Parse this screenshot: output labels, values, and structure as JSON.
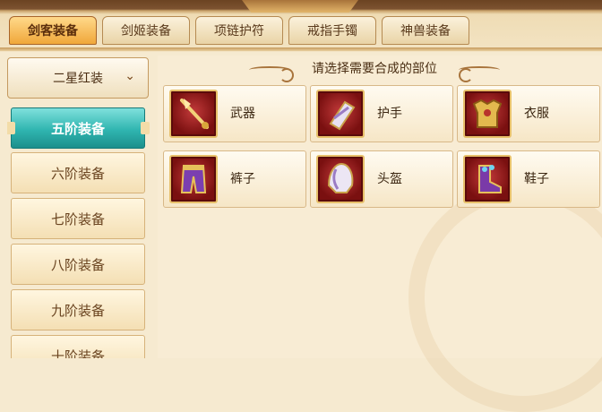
{
  "tabs": [
    {
      "label": "剑客装备",
      "active": true
    },
    {
      "label": "剑姬装备",
      "active": false
    },
    {
      "label": "项链护符",
      "active": false
    },
    {
      "label": "戒指手镯",
      "active": false
    },
    {
      "label": "神兽装备",
      "active": false
    }
  ],
  "grade_select": {
    "value": "二星红装"
  },
  "sidebar": {
    "items": [
      {
        "label": "五阶装备",
        "active": true
      },
      {
        "label": "六阶装备",
        "active": false
      },
      {
        "label": "七阶装备",
        "active": false
      },
      {
        "label": "八阶装备",
        "active": false
      },
      {
        "label": "九阶装备",
        "active": false
      },
      {
        "label": "十阶装备",
        "active": false
      }
    ]
  },
  "main": {
    "heading": "请选择需要合成的部位",
    "slots": [
      {
        "label": "武器",
        "icon": "weapon-icon"
      },
      {
        "label": "护手",
        "icon": "gauntlet-icon"
      },
      {
        "label": "衣服",
        "icon": "armor-icon"
      },
      {
        "label": "裤子",
        "icon": "pants-icon"
      },
      {
        "label": "头盔",
        "icon": "helmet-icon"
      },
      {
        "label": "鞋子",
        "icon": "boots-icon"
      }
    ]
  },
  "colors": {
    "accent_active_tab": "#f0a73a",
    "accent_active_item": "#2fb5b0",
    "slot_icon_bg": "#a02020"
  }
}
